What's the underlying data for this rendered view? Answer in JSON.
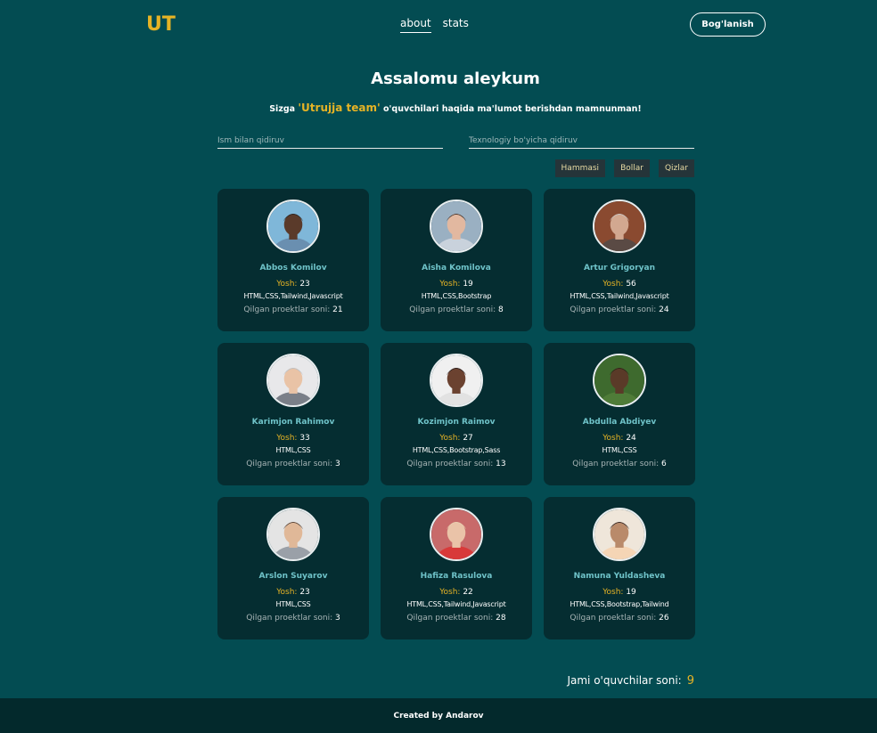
{
  "header": {
    "logo": "UT",
    "nav": [
      {
        "label": "about",
        "active": true
      },
      {
        "label": "stats",
        "active": false
      }
    ],
    "contact_button": "Bog'lanish"
  },
  "hero": {
    "title": "Assalomu aleykum",
    "subtitle_prefix": "Sizga ",
    "subtitle_brand": "'Utrujja team'",
    "subtitle_suffix": " o'quvchilari haqida ma'lumot berishdan mamnunman!"
  },
  "search": {
    "name_placeholder": "Ism bilan qidiruv",
    "tech_placeholder": "Texnologiy bo'yicha qidiruv"
  },
  "filters": [
    "Hammasi",
    "Bollar",
    "Qizlar"
  ],
  "labels": {
    "age": "Yosh:",
    "projects": "Qilgan proektlar soni:"
  },
  "students": [
    {
      "name": "Abbos Komilov",
      "age": "23",
      "tech": "HTML,CSS,Tailwind,Javascript",
      "projects": "21",
      "avatar_icon": "man-portrait-icon"
    },
    {
      "name": "Aisha Komilova",
      "age": "19",
      "tech": "HTML,CSS,Bootstrap",
      "projects": "8",
      "avatar_icon": "woman-portrait-icon"
    },
    {
      "name": "Artur Grigoryan",
      "age": "56",
      "tech": "HTML,CSS,Tailwind,Javascript",
      "projects": "24",
      "avatar_icon": "man-portrait-icon"
    },
    {
      "name": "Karimjon Rahimov",
      "age": "33",
      "tech": "HTML,CSS",
      "projects": "3",
      "avatar_icon": "man-portrait-icon"
    },
    {
      "name": "Kozimjon Raimov",
      "age": "27",
      "tech": "HTML,CSS,Bootstrap,Sass",
      "projects": "13",
      "avatar_icon": "man-portrait-icon"
    },
    {
      "name": "Abdulla Abdiyev",
      "age": "24",
      "tech": "HTML,CSS",
      "projects": "6",
      "avatar_icon": "man-portrait-icon"
    },
    {
      "name": "Arslon Suyarov",
      "age": "23",
      "tech": "HTML,CSS",
      "projects": "3",
      "avatar_icon": "man-portrait-icon"
    },
    {
      "name": "Hafiza Rasulova",
      "age": "22",
      "tech": "HTML,CSS,Tailwind,Javascript",
      "projects": "28",
      "avatar_icon": "woman-portrait-icon"
    },
    {
      "name": "Namuna Yuldasheva",
      "age": "19",
      "tech": "HTML,CSS,Bootstrap,Tailwind",
      "projects": "26",
      "avatar_icon": "woman-portrait-icon"
    }
  ],
  "total": {
    "label": "Jami o'quvchilar soni:",
    "count": "9"
  },
  "footer": {
    "text": "Created by Andarov"
  },
  "colors": {
    "background": "#034c52",
    "card": "#052d31",
    "accent": "#e6b325",
    "name": "#6fc3c9",
    "footer": "#03292c"
  }
}
